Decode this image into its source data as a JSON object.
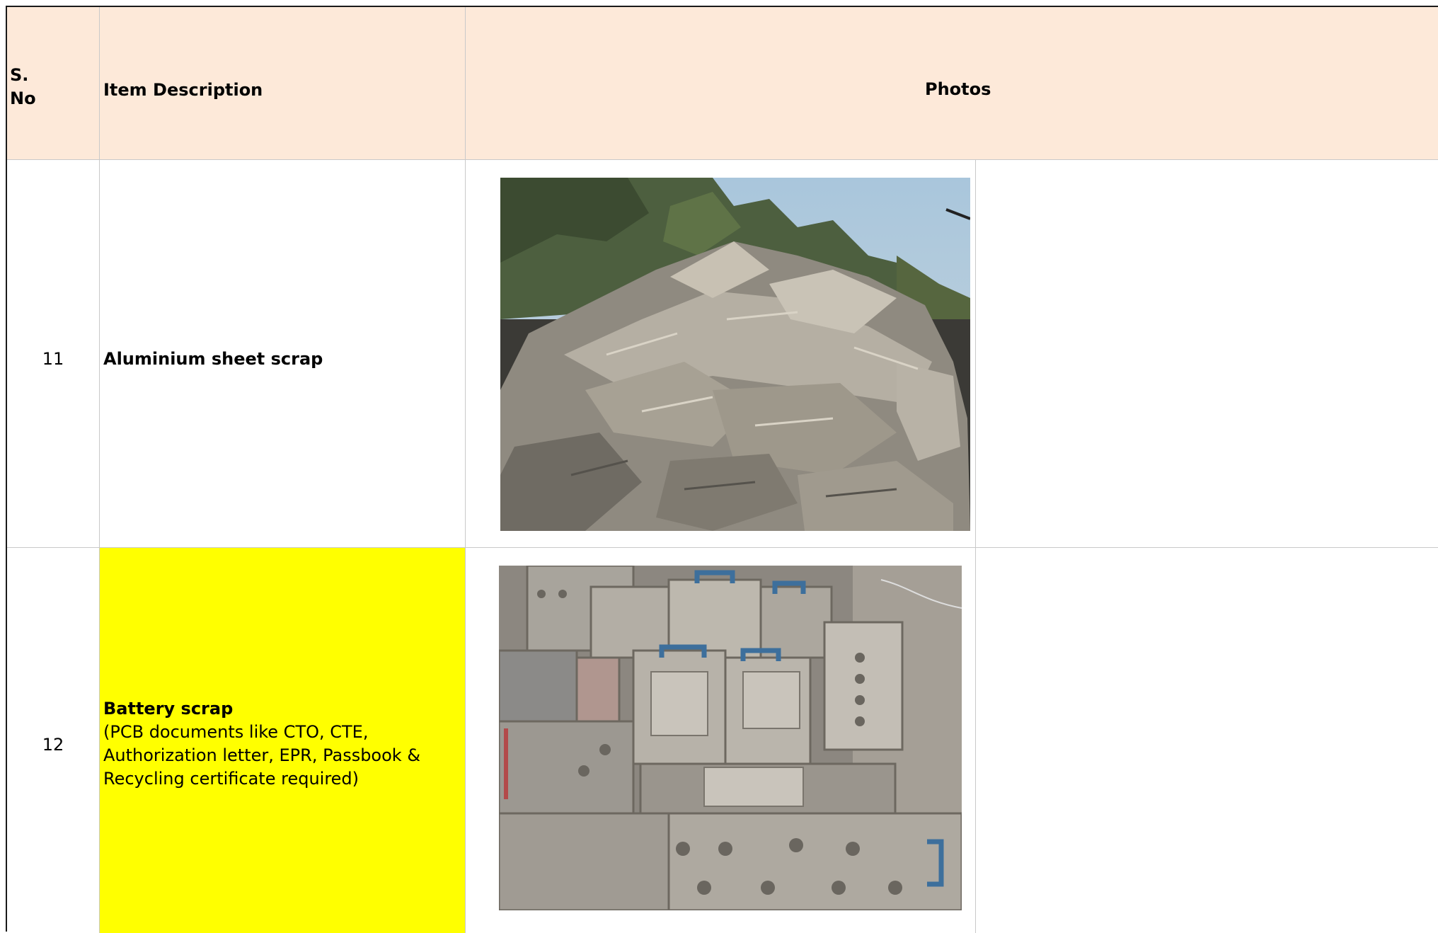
{
  "table": {
    "headers": {
      "sno": [
        "S.",
        "No"
      ],
      "description": "Item Description",
      "photos": "Photos"
    },
    "rows": [
      {
        "sno": "11",
        "title": "Aluminium sheet scrap",
        "details": [],
        "highlight": "",
        "photo": "aluminium-scrap-photo"
      },
      {
        "sno": "12",
        "title": "Battery scrap",
        "details": [
          "(PCB documents like CTO, CTE,",
          "Authorization letter, EPR, Passbook &",
          "Recycling certificate required)"
        ],
        "highlight": "#ffff00",
        "photo": "battery-scrap-photo"
      }
    ]
  }
}
